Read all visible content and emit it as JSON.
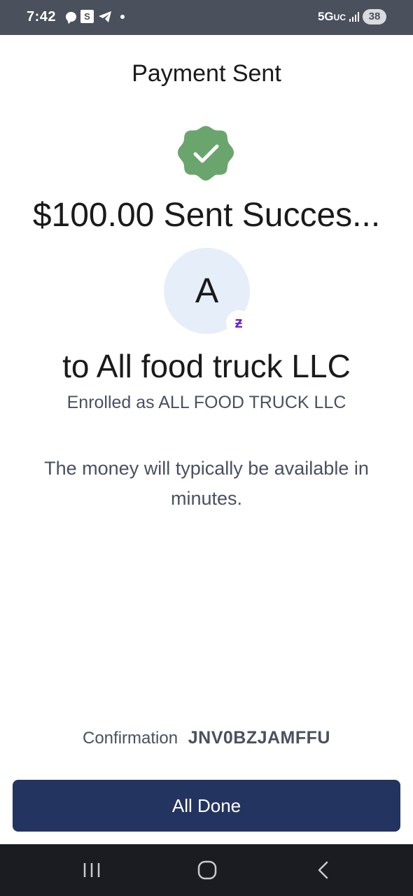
{
  "status_bar": {
    "time": "7:42",
    "s_icon": "S",
    "network": "5G",
    "network_suffix": "UC",
    "battery": "38",
    "icons": [
      "chat-bubble-icon",
      "s-app-icon",
      "telegram-icon",
      "notification-dot-icon",
      "signal-icon"
    ]
  },
  "header": {
    "title": "Payment Sent"
  },
  "success": {
    "icon": "checkmark-badge-icon",
    "heading": "$100.00 Sent Succes...",
    "color": "#6aa56d"
  },
  "recipient": {
    "avatar_letter": "A",
    "badge_glyph": "ƶ",
    "badge_icon": "zelle-icon",
    "name": "to All food truck LLC",
    "enrolled": "Enrolled as ALL FOOD TRUCK LLC"
  },
  "message": "The money will typically be available in minutes.",
  "confirmation": {
    "label": "Confirmation",
    "code": "JNV0BZJAMFFU"
  },
  "done_button": {
    "label": "All Done",
    "color": "#233460"
  },
  "nav": {
    "icons": [
      "recent-apps-icon",
      "home-icon",
      "back-icon"
    ]
  }
}
